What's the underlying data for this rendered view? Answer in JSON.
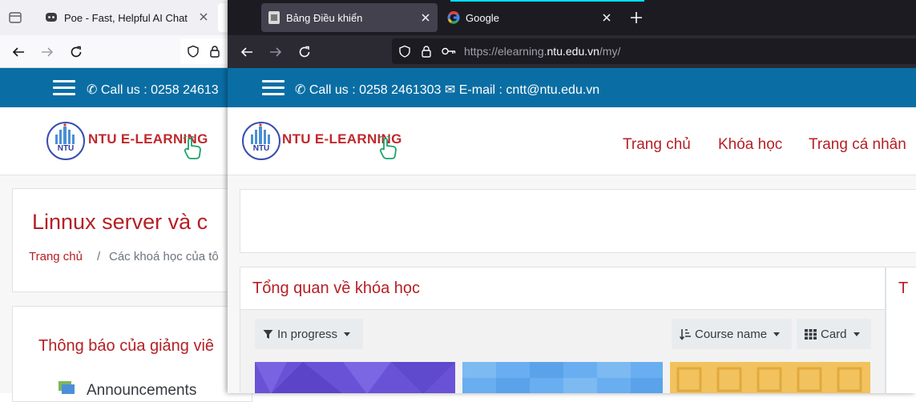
{
  "back_window": {
    "tabs": [
      {
        "label": "Poe - Fast, Helpful AI Chat",
        "icon": "poe-icon"
      }
    ],
    "site": {
      "call_text": "Call us : 0258 24613",
      "logo_text": "NTU E-LEARNING",
      "course_title": "Linnux server và c",
      "breadcrumb_home": "Trang chủ",
      "breadcrumb_sep": "/",
      "breadcrumb_current": "Các khoá học của tô",
      "announcement_heading": "Thông báo của giảng viê",
      "announcements_label": "Announcements"
    }
  },
  "front_window": {
    "tabs": [
      {
        "label": "Bảng Điều khiển",
        "icon": "moodle-favicon",
        "active": true
      },
      {
        "label": "Google",
        "icon": "google-icon",
        "active": false
      }
    ],
    "url": {
      "prefix": "https://elearning.",
      "domain": "ntu.edu.vn",
      "path": "/my/"
    },
    "site": {
      "call_text": "Call us : 0258 2461303",
      "email_text": "E-mail : cntt@ntu.edu.vn",
      "logo_text": "NTU E-LEARNING",
      "nav": [
        "Trang chủ",
        "Khóa học",
        "Trang cá nhân"
      ],
      "overview_title": "Tổng quan về khóa học",
      "filter_label": "In progress",
      "sort_label": "Course name",
      "view_label": "Card",
      "side_title_fragment": "T"
    }
  },
  "colors": {
    "site_blue": "#0a6ea4",
    "brand_red": "#b52025",
    "dark_tabbar": "#1c1b22",
    "light_tabbar": "#f0f0f4"
  }
}
